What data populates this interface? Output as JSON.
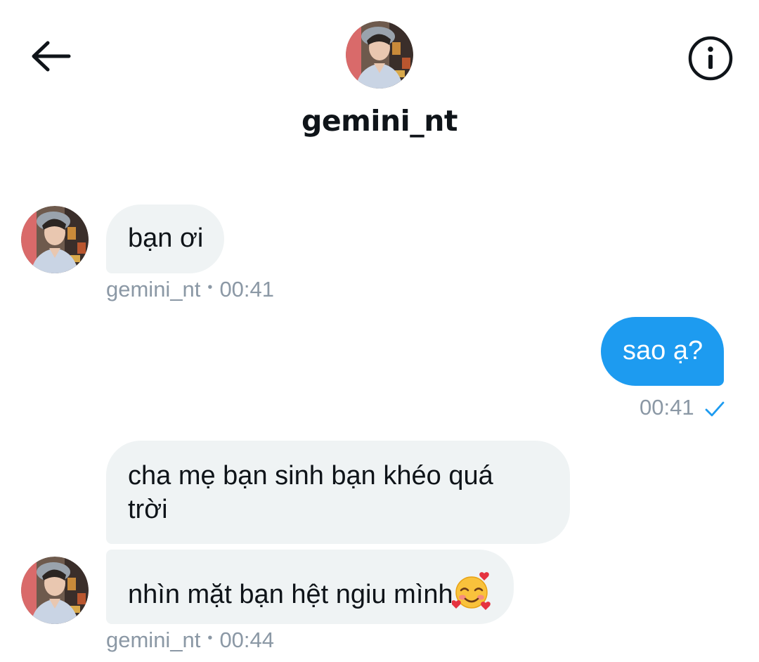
{
  "header": {
    "username": "gemini_nt",
    "back_icon": "arrow-left-icon",
    "info_icon": "info-circle-icon"
  },
  "messages": [
    {
      "direction": "incoming",
      "text": "bạn ơi",
      "sender": "gemini_nt",
      "time": "00:41"
    },
    {
      "direction": "outgoing",
      "text": "sao ạ?",
      "time": "00:41",
      "status_icon": "check-icon"
    },
    {
      "direction": "incoming",
      "text_lines": [
        "cha mẹ bạn sinh bạn khéo quá",
        "trời"
      ]
    },
    {
      "direction": "incoming",
      "text": "nhìn mặt bạn hệt ngiu mình",
      "emoji": "smiling-face-with-hearts",
      "sender": "gemini_nt",
      "time": "00:44"
    }
  ],
  "colors": {
    "incoming_bubble": "#eff3f4",
    "outgoing_bubble": "#1d9bf0",
    "meta_text": "#8b98a5",
    "check": "#1d9bf0"
  }
}
